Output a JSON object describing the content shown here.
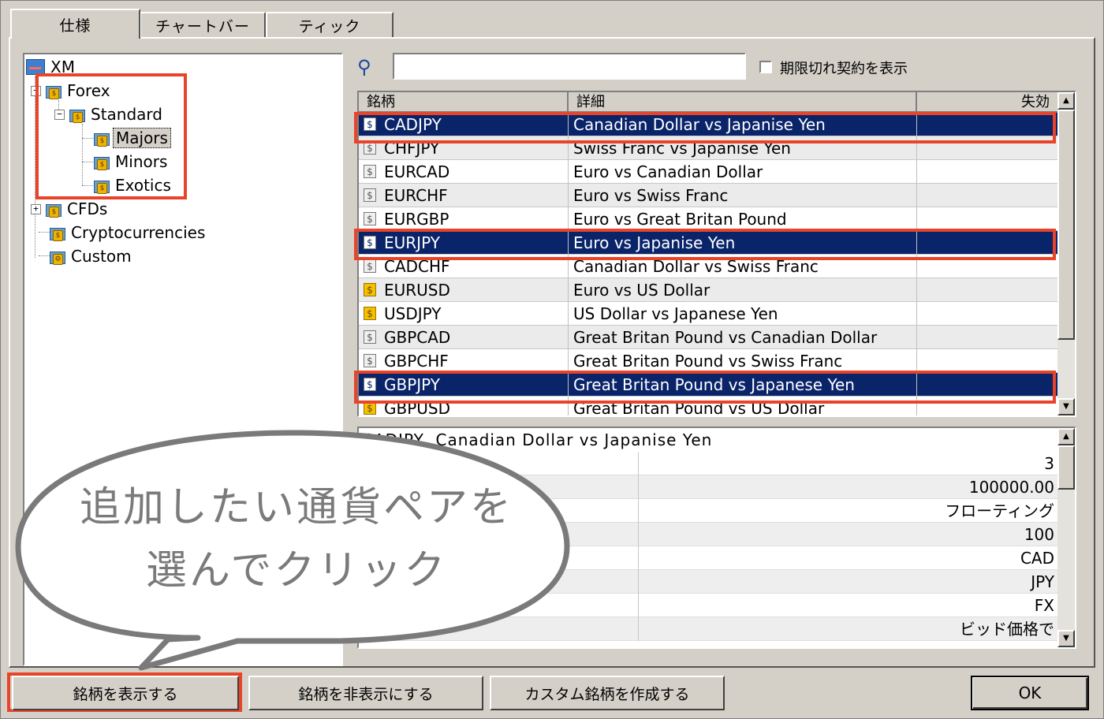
{
  "tabs": [
    "仕様",
    "チャートバー",
    "ティック"
  ],
  "tree": {
    "root": "XM",
    "forex": "Forex",
    "standard": "Standard",
    "majors": "Majors",
    "minors": "Minors",
    "exotics": "Exotics",
    "cfds": "CFDs",
    "crypto": "Cryptocurrencies",
    "custom": "Custom"
  },
  "search": {
    "value": "",
    "expired_label": "期限切れ契約を表示"
  },
  "table": {
    "headers": [
      "銘柄",
      "詳細",
      "失効"
    ],
    "rows": [
      {
        "symbol": "CADJPY",
        "desc": "Canadian Dollar vs Japanise Yen",
        "exp": ""
      },
      {
        "symbol": "CHFJPY",
        "desc": "Swiss Franc vs Japanise Yen",
        "exp": ""
      },
      {
        "symbol": "EURCAD",
        "desc": "Euro vs Canadian Dollar",
        "exp": ""
      },
      {
        "symbol": "EURCHF",
        "desc": "Euro vs Swiss Franc",
        "exp": ""
      },
      {
        "symbol": "EURGBP",
        "desc": "Euro vs Great Britan Pound",
        "exp": ""
      },
      {
        "symbol": "EURJPY",
        "desc": "Euro vs Japanise Yen",
        "exp": ""
      },
      {
        "symbol": "CADCHF",
        "desc": "Canadian Dollar vs Swiss Franc",
        "exp": ""
      },
      {
        "symbol": "EURUSD",
        "desc": "Euro vs US Dollar",
        "exp": ""
      },
      {
        "symbol": "USDJPY",
        "desc": "US Dollar vs Japanese Yen",
        "exp": ""
      },
      {
        "symbol": "GBPCAD",
        "desc": "Great Britan Pound vs Canadian Dollar",
        "exp": ""
      },
      {
        "symbol": "GBPCHF",
        "desc": "Great Britan Pound vs Swiss Franc",
        "exp": ""
      },
      {
        "symbol": "GBPJPY",
        "desc": "Great Britan Pound vs Japanese Yen",
        "exp": ""
      },
      {
        "symbol": "GBPUSD",
        "desc": "Great Britan Pound vs US Dollar",
        "exp": ""
      }
    ]
  },
  "spec": {
    "title": "CADJPY, Canadian Dollar vs Japanise Yen",
    "values": [
      "3",
      "100000.00",
      "フローティング",
      "100",
      "CAD",
      "JPY",
      "FX",
      "ビッド価格で"
    ]
  },
  "callout": {
    "line1": "追加したい通貨ペアを",
    "line2": "選んでクリック"
  },
  "buttons": {
    "show": "銘柄を表示する",
    "hide": "銘柄を非表示にする",
    "custom": "カスタム銘柄を作成する",
    "ok": "OK"
  },
  "colors": {
    "selection": "#0a246a",
    "highlight": "#e8442a",
    "callout_text": "#7a7a7a"
  }
}
